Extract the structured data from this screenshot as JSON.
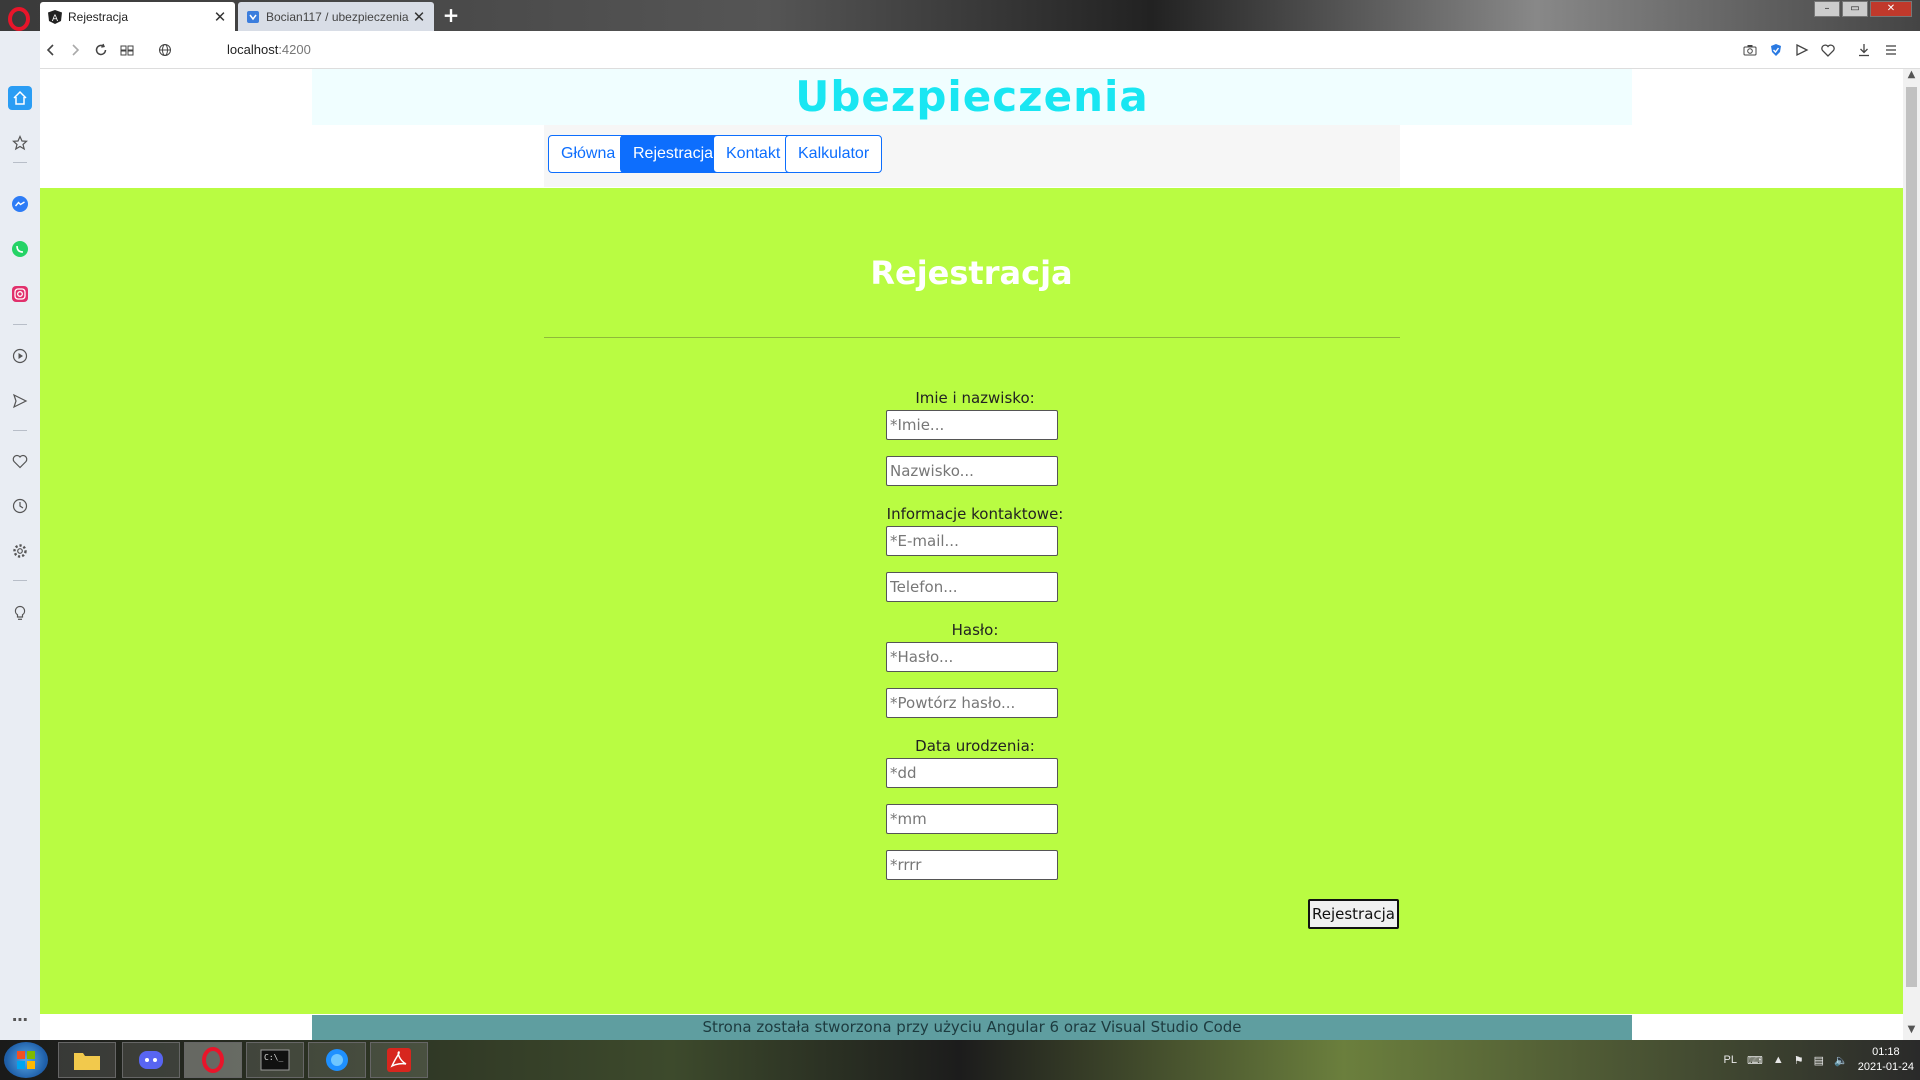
{
  "browser": {
    "tabs": [
      {
        "title": "Rejestracja",
        "active": true,
        "icon": "angular-icon"
      },
      {
        "title": "Bocian117 / ubezpieczenia",
        "active": false,
        "icon": "github-icon"
      }
    ],
    "new_tab_label": "+",
    "url_host": "localhost",
    "url_port": ":4200"
  },
  "site": {
    "title": "Ubezpieczenia",
    "nav": [
      {
        "label": "Główna",
        "active": false
      },
      {
        "label": "Rejestracja",
        "active": true
      },
      {
        "label": "Kontakt",
        "active": false
      },
      {
        "label": "Kalkulator",
        "active": false
      }
    ]
  },
  "form": {
    "heading": "Rejestracja",
    "groups": [
      {
        "label": "Imie i nazwisko:",
        "fields": [
          {
            "placeholder": "*Imie...",
            "value": ""
          },
          {
            "placeholder": "Nazwisko...",
            "value": ""
          }
        ]
      },
      {
        "label": "Informacje kontaktowe:",
        "fields": [
          {
            "placeholder": "*E-mail...",
            "value": ""
          },
          {
            "placeholder": "Telefon...",
            "value": ""
          }
        ]
      },
      {
        "label": "Hasło:",
        "fields": [
          {
            "placeholder": "*Hasło...",
            "value": ""
          },
          {
            "placeholder": "*Powtórz hasło...",
            "value": ""
          }
        ]
      },
      {
        "label": "Data urodzenia:",
        "fields": [
          {
            "placeholder": "*dd",
            "value": ""
          },
          {
            "placeholder": "*mm",
            "value": ""
          },
          {
            "placeholder": "*rrrr",
            "value": ""
          }
        ]
      }
    ],
    "submit_label": "Rejestracja"
  },
  "footer": {
    "text": "Strona została stworzona przy użyciu Angular 6 oraz Visual Studio Code"
  },
  "taskbar": {
    "language": "PL",
    "time": "01:18",
    "date": "2021-01-24"
  },
  "colors": {
    "title_cyan": "#19e6f2",
    "primary_blue": "#0d6efd",
    "main_green": "#b9fc42",
    "footer_teal": "#5f9ea0"
  }
}
